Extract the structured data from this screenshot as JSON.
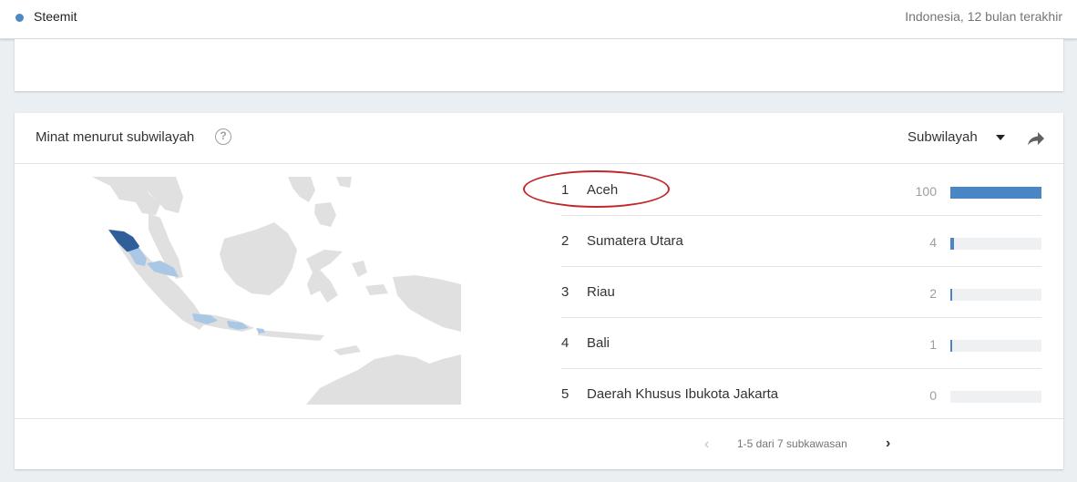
{
  "topbar": {
    "term": "Steemit",
    "term_color": "#4e88c7",
    "scope": "Indonesia, 12 bulan terakhir"
  },
  "card": {
    "title": "Minat menurut subwilayah",
    "help_icon": "help-circle-icon",
    "dropdown_label": "Subwilayah",
    "share_icon": "share-icon"
  },
  "rankings": [
    {
      "rank": "1",
      "name": "Aceh",
      "value": "100",
      "fraction": 1.0
    },
    {
      "rank": "2",
      "name": "Sumatera Utara",
      "value": "4",
      "fraction": 0.04
    },
    {
      "rank": "3",
      "name": "Riau",
      "value": "2",
      "fraction": 0.02
    },
    {
      "rank": "4",
      "name": "Bali",
      "value": "1",
      "fraction": 0.01
    },
    {
      "rank": "5",
      "name": "Daerah Khusus Ibukota Jakarta",
      "value": "0",
      "fraction": 0.0
    }
  ],
  "pager": {
    "text": "1-5 dari 7 subkawasan",
    "prev_icon": "chevron-left-icon",
    "next_icon": "chevron-right-icon"
  },
  "colors": {
    "bar": "#4a86c5",
    "bar_bg": "#eef0f2",
    "map_land": "#e0e0e0",
    "map_high": "#2e5f9b",
    "map_low": "#aac8e6",
    "annotation": "#c0282d"
  }
}
